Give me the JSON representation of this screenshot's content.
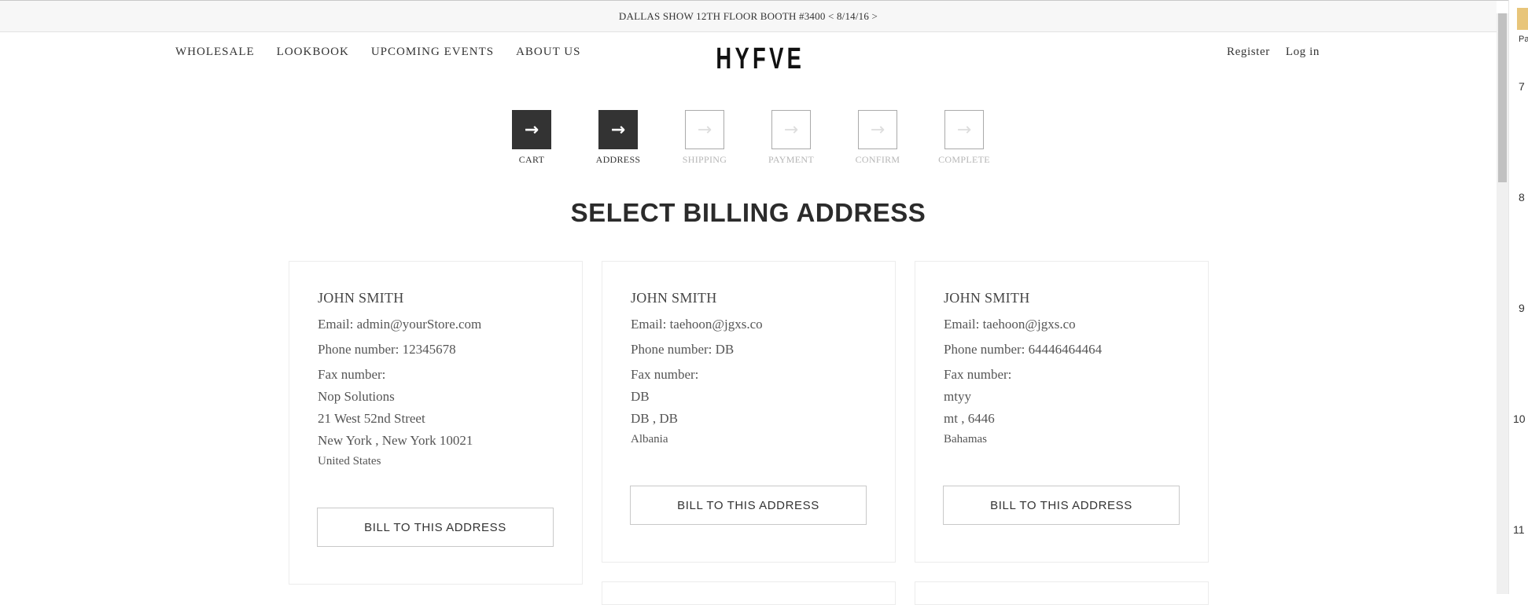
{
  "announcement": "DALLAS SHOW 12TH FLOOR BOOTH #3400 < 8/14/16 >",
  "nav_left": [
    "WHOLESALE",
    "LOOKBOOK",
    "UPCOMING EVENTS",
    "ABOUT US"
  ],
  "logo": "HYFVE",
  "nav_right": [
    "Register",
    "Log in"
  ],
  "steps": [
    {
      "label": "CART",
      "icon": "arrow-right-icon",
      "glyph": "→"
    },
    {
      "label": "ADDRESS",
      "icon": "arrow-right-icon",
      "glyph": "→"
    },
    {
      "label": "SHIPPING",
      "icon": "arrow-right-icon",
      "glyph": "→"
    },
    {
      "label": "PAYMENT",
      "icon": "arrow-right-icon",
      "glyph": "→"
    },
    {
      "label": "CONFIRM",
      "icon": "arrow-right-icon",
      "glyph": "→"
    },
    {
      "label": "COMPLETE",
      "icon": "arrow-right-icon",
      "glyph": "→"
    }
  ],
  "page_title": "SELECT BILLING ADDRESS",
  "addresses": [
    {
      "name": "JOHN SMITH",
      "email": "Email: admin@yourStore.com",
      "phone": "Phone number: 12345678",
      "fax": "Fax number:",
      "company": "Nop Solutions",
      "street": "21 West 52nd Street",
      "city": "New York , New York 10021",
      "country": "United States",
      "button": "BILL TO THIS ADDRESS"
    },
    {
      "name": "JOHN SMITH",
      "email": "Email: taehoon@jgxs.co",
      "phone": "Phone number: DB",
      "fax": "Fax number:",
      "street": "DB",
      "city": "DB , DB",
      "country": "Albania",
      "button": "BILL TO THIS ADDRESS"
    },
    {
      "name": "JOHN SMITH",
      "email": "Email: taehoon@jgxs.co",
      "phone": "Phone number: 64446464464",
      "fax": "Fax number:",
      "street": "mtyy",
      "city": "mt , 6446",
      "country": "Bahamas",
      "button": "BILL TO THIS ADDRESS"
    }
  ],
  "right_strip": {
    "label": "Pa",
    "line_numbers": [
      "7",
      "8",
      "9",
      "10",
      "11"
    ]
  }
}
